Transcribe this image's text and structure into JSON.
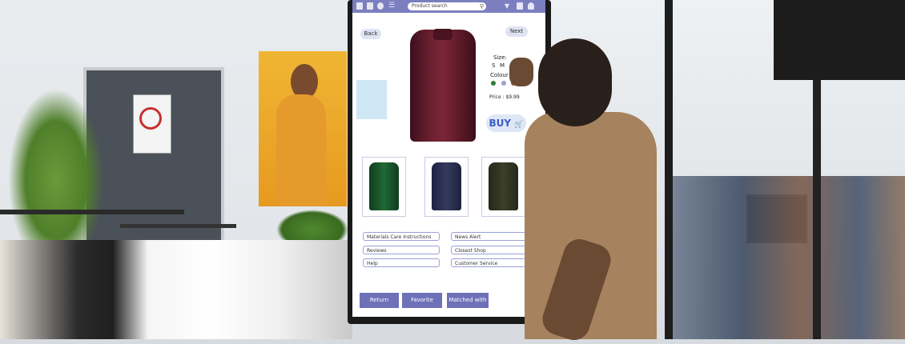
{
  "kiosk": {
    "search": {
      "placeholder": "Product search"
    },
    "nav": {
      "back_label": "Back",
      "next_label": "Next"
    },
    "product": {
      "size_label": "Size:",
      "sizes": [
        "S",
        "M"
      ],
      "colour_label": "Colour Choic",
      "colours": [
        "#2f7a3c",
        "#9aa0c8",
        "#8a5a52"
      ],
      "price_label": "Price : $9.99",
      "buy_label": "BUY"
    },
    "links": {
      "left": [
        "Materials Care Instructions",
        "Reviews",
        "Help"
      ],
      "right": [
        "News Alert",
        "Closest Shop",
        "Customer Service"
      ]
    },
    "buttons": [
      "Return",
      "Favorite",
      "Matched with"
    ],
    "colors": {
      "accent": "#7b7fc0",
      "button": "#6e71b8"
    }
  }
}
